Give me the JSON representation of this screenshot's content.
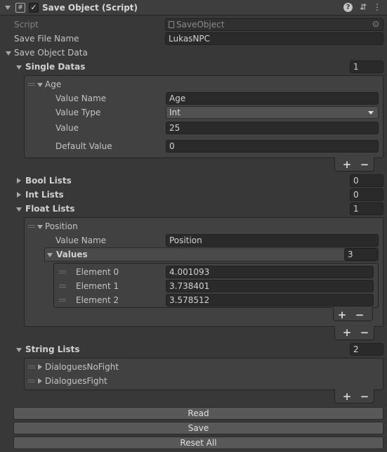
{
  "header": {
    "title": "Save Object (Script)",
    "script_icon_glyph": "#",
    "check_glyph": "✓",
    "help_glyph": "?",
    "settings_glyph": "⇵",
    "menu_glyph": "⋮",
    "enabled": true
  },
  "script_field": {
    "label": "Script",
    "value": "SaveObject",
    "target_glyph": "⊙"
  },
  "save_file_name": {
    "label": "Save File Name",
    "value": "LukasNPC"
  },
  "save_object_data": {
    "label": "Save Object Data"
  },
  "single_datas": {
    "label": "Single Datas",
    "count": "1",
    "items": [
      {
        "label": "Age",
        "value_name": {
          "label": "Value Name",
          "value": "Age"
        },
        "value_type": {
          "label": "Value Type",
          "value": "Int"
        },
        "value": {
          "label": "Value",
          "value": "25"
        },
        "default_value": {
          "label": "Default Value",
          "value": "0"
        }
      }
    ]
  },
  "bool_lists": {
    "label": "Bool Lists",
    "count": "0"
  },
  "int_lists": {
    "label": "Int Lists",
    "count": "0"
  },
  "float_lists": {
    "label": "Float Lists",
    "count": "1",
    "items": [
      {
        "label": "Position",
        "value_name": {
          "label": "Value Name",
          "value": "Position"
        },
        "values": {
          "label": "Values",
          "count": "3",
          "elements": [
            {
              "label": "Element 0",
              "value": "4.001093"
            },
            {
              "label": "Element 1",
              "value": "3.738401"
            },
            {
              "label": "Element 2",
              "value": "3.578512"
            }
          ]
        }
      }
    ]
  },
  "string_lists": {
    "label": "String Lists",
    "count": "2",
    "items": [
      {
        "label": "DialoguesNoFight"
      },
      {
        "label": "DialoguesFight"
      }
    ]
  },
  "list_controls": {
    "add": "+",
    "remove": "−"
  },
  "buttons": {
    "read": "Read",
    "save": "Save",
    "reset_all": "Reset All"
  }
}
